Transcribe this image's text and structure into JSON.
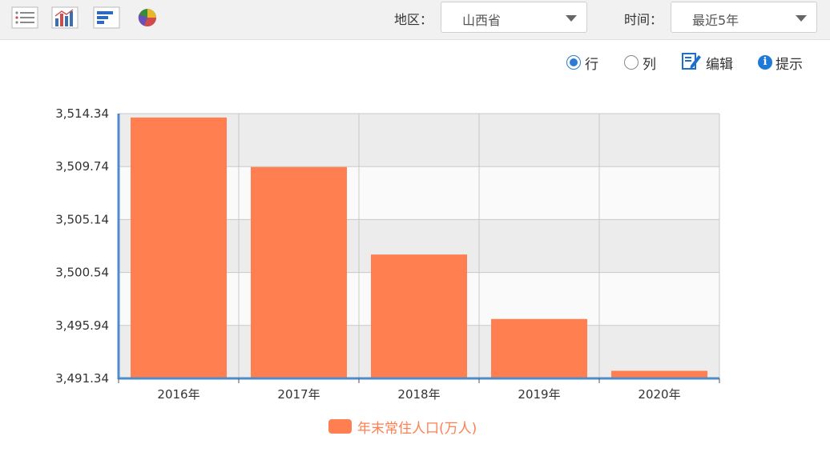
{
  "toolbar": {
    "icons": [
      "list-view-icon",
      "bar-chart-icon",
      "horizontal-bar-icon",
      "pie-chart-icon"
    ],
    "region_label": "地区：",
    "region_value": "山西省",
    "time_label": "时间：",
    "time_value": "最近5年"
  },
  "options": {
    "row_label": "行",
    "col_label": "列",
    "edit_label": "编辑",
    "hint_label": "提示",
    "selected": "row"
  },
  "chart_data": {
    "type": "bar",
    "categories": [
      "2016年",
      "2017年",
      "2018年",
      "2019年",
      "2020年"
    ],
    "series": [
      {
        "name": "年末常住人口(万人)",
        "values": [
          3514.0,
          3509.7,
          3502.1,
          3496.5,
          3492.0
        ]
      }
    ],
    "ylim": [
      3491.34,
      3514.34
    ],
    "yticks": [
      "3,514.34",
      "3,509.74",
      "3,505.14",
      "3,500.54",
      "3,495.94",
      "3,491.34"
    ],
    "grid": true,
    "legend_position": "bottom-center",
    "bar_color": "#ff7f50",
    "axis_color": "#4f8cc9"
  }
}
